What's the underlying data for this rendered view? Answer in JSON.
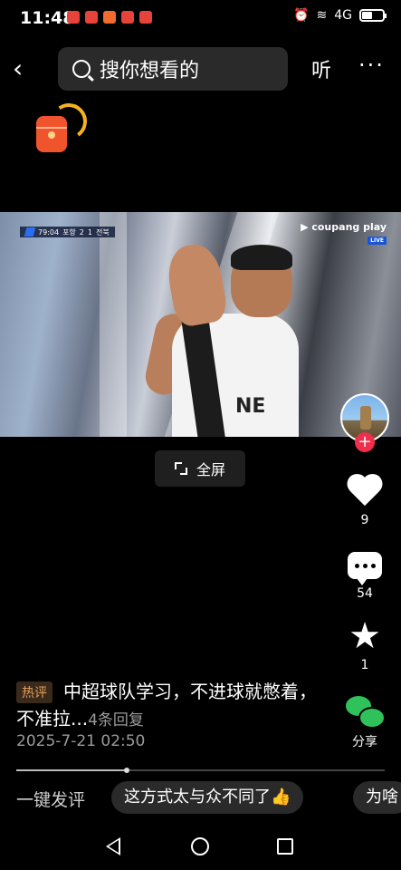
{
  "status_bar": {
    "time": "11:48",
    "network": "4G"
  },
  "header": {
    "back_glyph": "‹",
    "search_placeholder": "搜你想看的",
    "listen_label": "听",
    "more_glyph": "···"
  },
  "video": {
    "broadcaster": "coupang play",
    "live_badge": "LIVE",
    "scoreboard": {
      "clock": "79:04",
      "home": "포항",
      "home_score": "2",
      "away_score": "1",
      "away": "전북"
    },
    "jersey_text": "NE"
  },
  "fullscreen_label": "全屏",
  "rail": {
    "likes": "9",
    "comments": "54",
    "favorites": "1",
    "share_label": "分享",
    "star_glyph": "★",
    "follow_glyph": "+"
  },
  "hot_comment": {
    "badge": "热评",
    "text": "中超球队学习，不进球就憋着，不准拉...",
    "replies": "4条回复",
    "time": "2025-7-21 02:50"
  },
  "progress": {
    "fraction": 0.3
  },
  "quick_comment": {
    "label": "一键发评",
    "chips": [
      "这方式太与众不同了👍",
      "为啥"
    ]
  }
}
